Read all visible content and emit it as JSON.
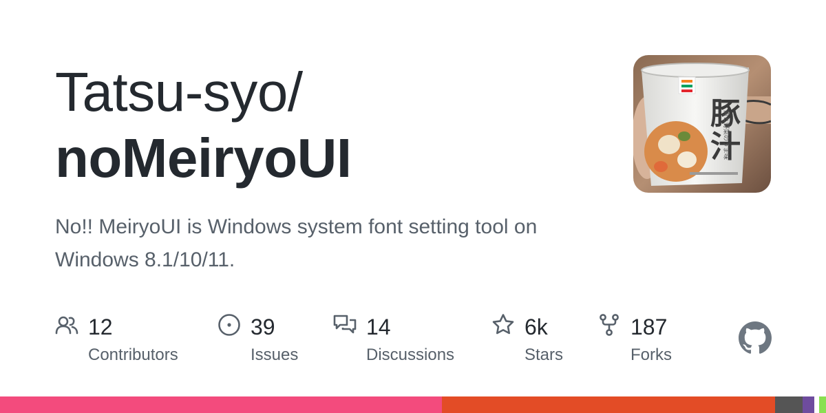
{
  "repo": {
    "owner": "Tatsu-syo/",
    "name": "noMeiryoUI",
    "description": "No!! MeiryoUI is Windows system font setting tool on Windows 8.1/10/11."
  },
  "stats": {
    "contributors": {
      "count": "12",
      "label": "Contributors",
      "icon": "people-icon"
    },
    "issues": {
      "count": "39",
      "label": "Issues",
      "icon": "issue-opened-icon"
    },
    "discussions": {
      "count": "14",
      "label": "Discussions",
      "icon": "comment-discussion-icon"
    },
    "stars": {
      "count": "6k",
      "label": "Stars",
      "icon": "star-icon"
    },
    "forks": {
      "count": "187",
      "label": "Forks",
      "icon": "repo-forked-icon"
    }
  },
  "colors": {
    "icon": "#57606a",
    "logo": "#6e7781",
    "language_bar": [
      "#f34b7d",
      "#e34c26",
      "#555555",
      "#6e4c9e",
      "#89e051"
    ]
  },
  "language_shares": [
    0.535,
    0.403,
    0.033,
    0.014,
    0.006,
    0.009
  ]
}
